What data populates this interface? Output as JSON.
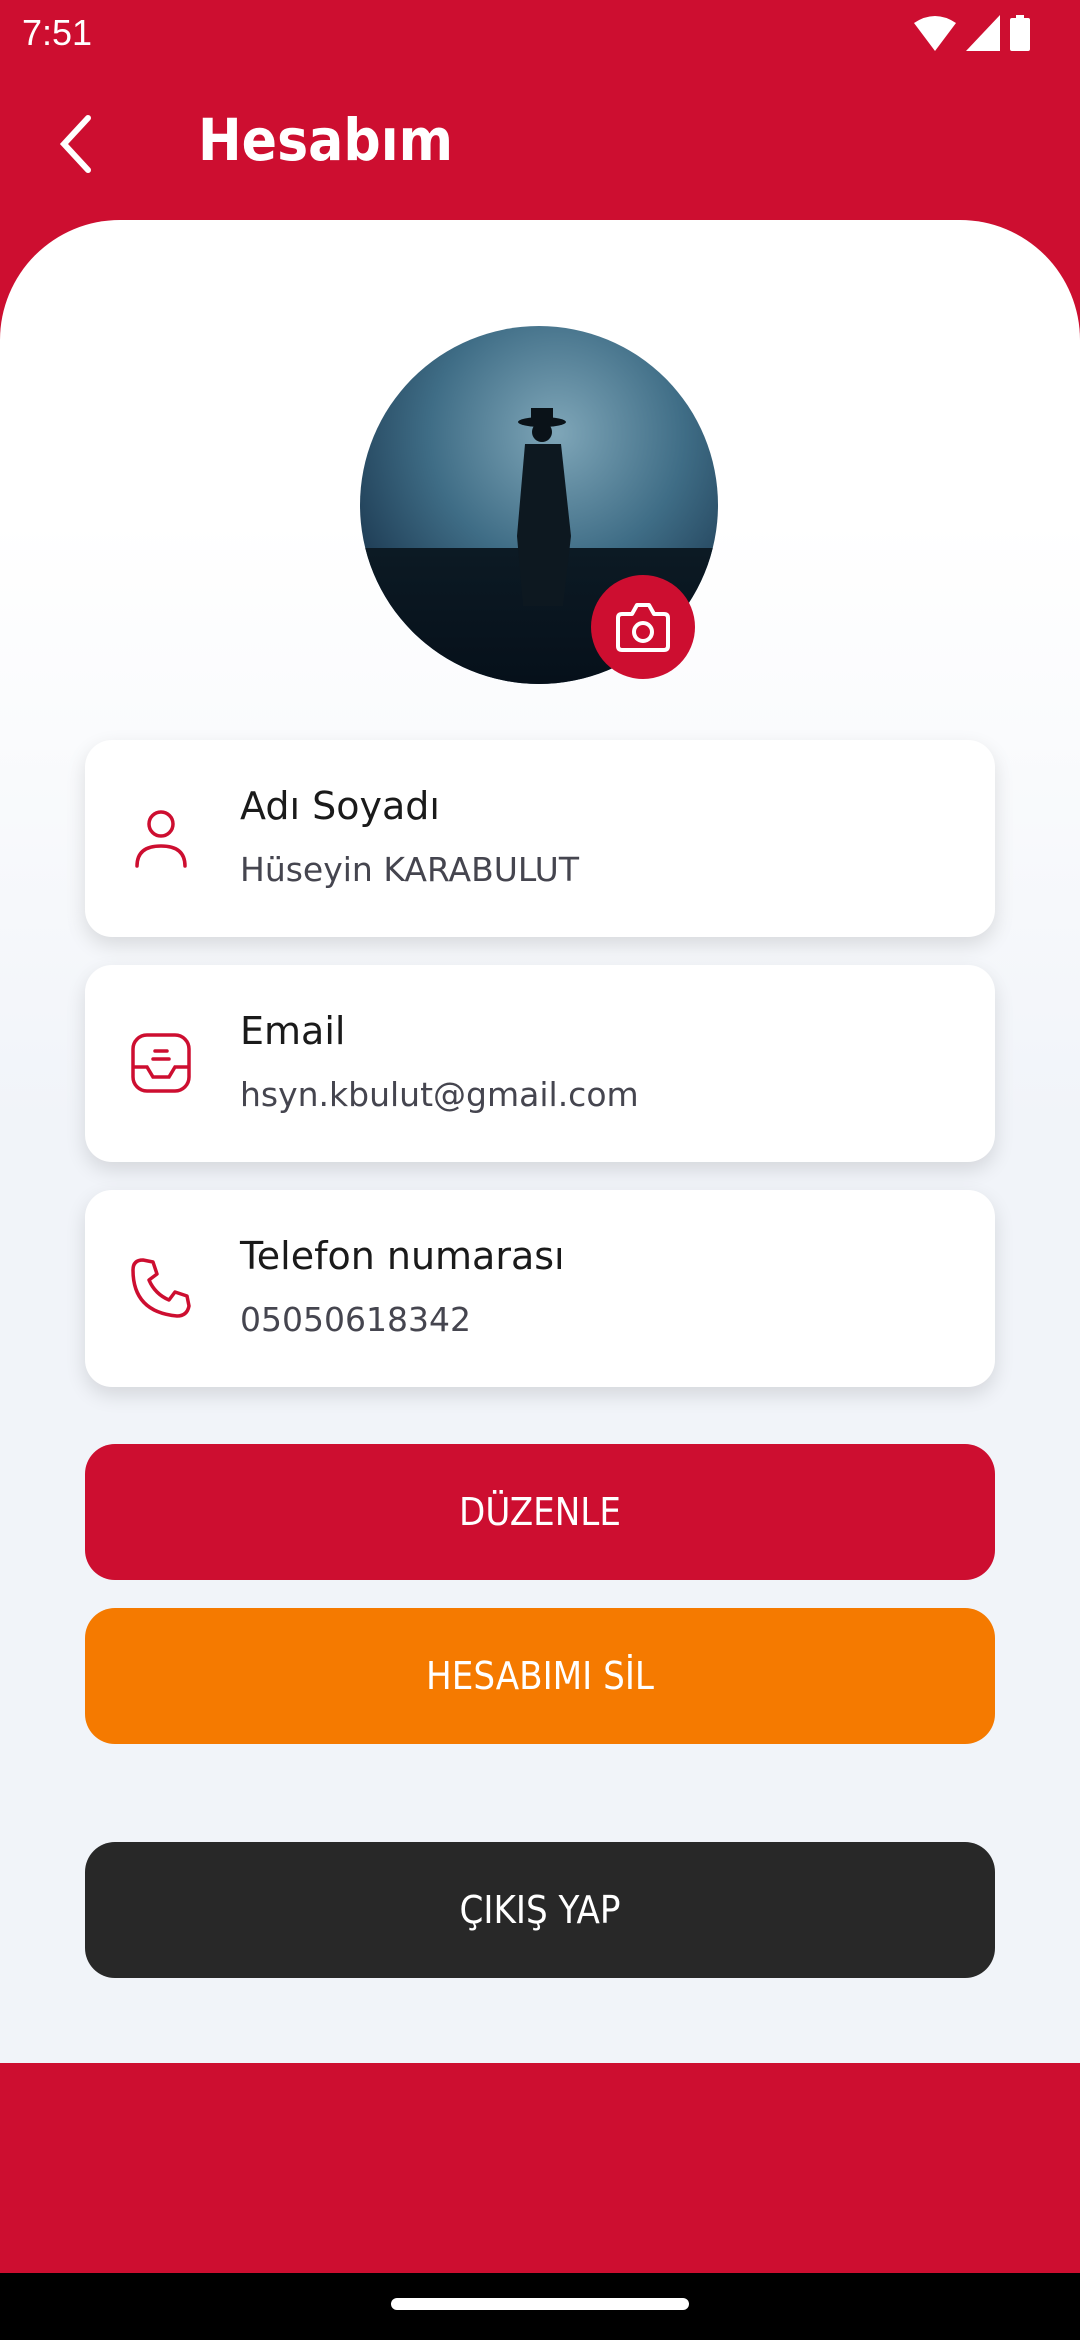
{
  "status_bar": {
    "time": "7:51",
    "icons": [
      "wifi-icon",
      "signal-icon",
      "battery-icon"
    ]
  },
  "header": {
    "title": "Hesabım",
    "back_icon": "chevron-left-icon"
  },
  "profile": {
    "avatar": "profile-photo",
    "camera_icon": "camera-icon"
  },
  "fields": [
    {
      "icon": "user-icon",
      "label": "Adı Soyadı",
      "value": "Hüseyin KARABULUT"
    },
    {
      "icon": "inbox-icon",
      "label": "Email",
      "value": "hsyn.kbulut@gmail.com"
    },
    {
      "icon": "phone-icon",
      "label": "Telefon numarası",
      "value": "05050618342"
    }
  ],
  "buttons": {
    "edit": "DÜZENLE",
    "delete": "HESABIMI SİL",
    "logout": "ÇIKIŞ YAP"
  },
  "colors": {
    "brand": "#cd0e30",
    "delete": "#f57a00",
    "logout": "#282828",
    "background": "#f1f4f9"
  }
}
